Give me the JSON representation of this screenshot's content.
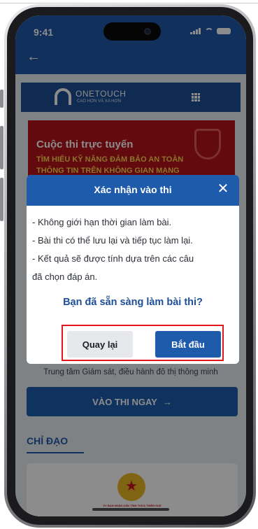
{
  "status_bar": {
    "time": "9:41"
  },
  "brand": {
    "name": "ONETOUCH",
    "tagline": "CAO HƠN VÀ XA HƠN"
  },
  "banner": {
    "title": "Cuộc thi trực tuyến",
    "line1": "TÌM HIỂU KỸ NĂNG ĐẢM BẢO AN TOÀN",
    "line2": "THÔNG TIN TRÊN KHÔNG GIAN MẠNG"
  },
  "modal": {
    "title": "Xác nhận vào thi",
    "rules": [
      "- Không giới hạn thời gian làm bài.",
      "- Bài thi có thể lưu lại và tiếp tục làm lại.",
      "- Kết quả sẽ được tính dựa trên các câu",
      "đã chọn đáp án."
    ],
    "question": "Bạn đã sẵn sàng làm bài thi?",
    "back_label": "Quay lại",
    "start_label": "Bắt đầu"
  },
  "page": {
    "subtitle": "Trung tâm Giám sát, điều hành đô thị thông minh",
    "cta_label": "VÀO THI NGAY",
    "section_title": "CHỈ ĐẠO",
    "emblem_caption": "ỦY BAN NHÂN DÂN TỈNH THỪA THIÊN HUẾ"
  },
  "colors": {
    "primary": "#1e5bab",
    "highlight_frame": "#e2171d",
    "banner": "#b2131b"
  }
}
